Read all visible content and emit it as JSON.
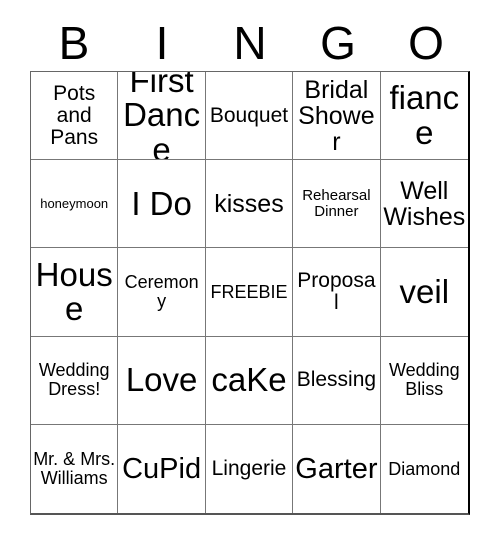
{
  "header": {
    "letters": [
      "B",
      "I",
      "N",
      "G",
      "O"
    ]
  },
  "grid": {
    "columns": 5,
    "rows": 5,
    "cells": [
      {
        "text": "Pots and Pans",
        "size": "fs-m"
      },
      {
        "text": "First Dance",
        "size": "fs-xxl"
      },
      {
        "text": "Bouquet",
        "size": "fs-m"
      },
      {
        "text": "Bridal Shower",
        "size": "fs-l"
      },
      {
        "text": "fiance",
        "size": "fs-xxl"
      },
      {
        "text": "honeymoon",
        "size": "fs-xxs"
      },
      {
        "text": "I Do",
        "size": "fs-xxl"
      },
      {
        "text": "kisses",
        "size": "fs-l"
      },
      {
        "text": "Rehearsal Dinner",
        "size": "fs-xs"
      },
      {
        "text": "Well Wishes",
        "size": "fs-l"
      },
      {
        "text": "House",
        "size": "fs-xxl"
      },
      {
        "text": "Ceremony",
        "size": "fs-s"
      },
      {
        "text": "FREEBIE",
        "size": "fs-s"
      },
      {
        "text": "Proposal",
        "size": "fs-m"
      },
      {
        "text": "veil",
        "size": "fs-xxl"
      },
      {
        "text": "Wedding Dress!",
        "size": "fs-s"
      },
      {
        "text": "Love",
        "size": "fs-xxl"
      },
      {
        "text": "caKe",
        "size": "fs-xxl"
      },
      {
        "text": "Blessing",
        "size": "fs-m"
      },
      {
        "text": "Wedding Bliss",
        "size": "fs-s"
      },
      {
        "text": "Mr. & Mrs. Williams",
        "size": "fs-s"
      },
      {
        "text": "CuPid",
        "size": "fs-xl"
      },
      {
        "text": "Lingerie",
        "size": "fs-m"
      },
      {
        "text": "Garter",
        "size": "fs-xl"
      },
      {
        "text": "Diamond",
        "size": "fs-s"
      }
    ]
  }
}
